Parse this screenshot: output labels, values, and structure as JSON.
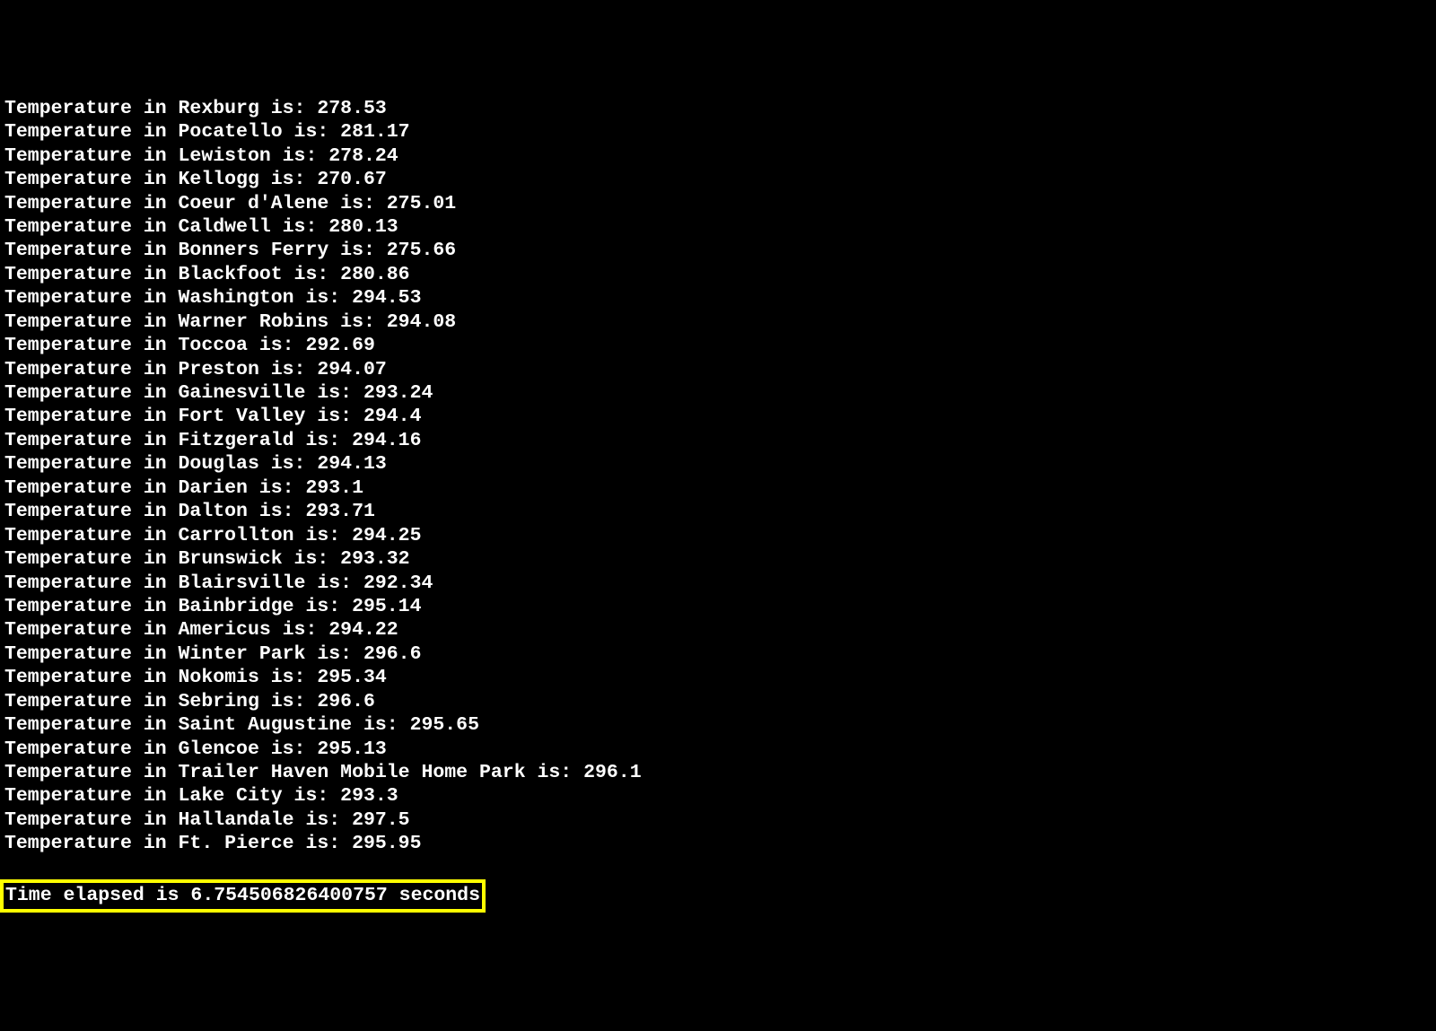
{
  "prefix": "Temperature in ",
  "separator": " is: ",
  "temperatures": [
    {
      "city": "Rexburg",
      "value": "278.53"
    },
    {
      "city": "Pocatello",
      "value": "281.17"
    },
    {
      "city": "Lewiston",
      "value": "278.24"
    },
    {
      "city": "Kellogg",
      "value": "270.67"
    },
    {
      "city": "Coeur d'Alene",
      "value": "275.01"
    },
    {
      "city": "Caldwell",
      "value": "280.13"
    },
    {
      "city": "Bonners Ferry",
      "value": "275.66"
    },
    {
      "city": "Blackfoot",
      "value": "280.86"
    },
    {
      "city": "Washington",
      "value": "294.53"
    },
    {
      "city": "Warner Robins",
      "value": "294.08"
    },
    {
      "city": "Toccoa",
      "value": "292.69"
    },
    {
      "city": "Preston",
      "value": "294.07"
    },
    {
      "city": "Gainesville",
      "value": "293.24"
    },
    {
      "city": "Fort Valley",
      "value": "294.4"
    },
    {
      "city": "Fitzgerald",
      "value": "294.16"
    },
    {
      "city": "Douglas",
      "value": "294.13"
    },
    {
      "city": "Darien",
      "value": "293.1"
    },
    {
      "city": "Dalton",
      "value": "293.71"
    },
    {
      "city": "Carrollton",
      "value": "294.25"
    },
    {
      "city": "Brunswick",
      "value": "293.32"
    },
    {
      "city": "Blairsville",
      "value": "292.34"
    },
    {
      "city": "Bainbridge",
      "value": "295.14"
    },
    {
      "city": "Americus",
      "value": "294.22"
    },
    {
      "city": "Winter Park",
      "value": "296.6"
    },
    {
      "city": "Nokomis",
      "value": "295.34"
    },
    {
      "city": "Sebring",
      "value": "296.6"
    },
    {
      "city": "Saint Augustine",
      "value": "295.65"
    },
    {
      "city": "Glencoe",
      "value": "295.13"
    },
    {
      "city": "Trailer Haven Mobile Home Park",
      "value": "296.1"
    },
    {
      "city": "Lake City",
      "value": "293.3"
    },
    {
      "city": "Hallandale",
      "value": "297.5"
    },
    {
      "city": "Ft. Pierce",
      "value": "295.95"
    }
  ],
  "elapsed": {
    "prefix": "Time elapsed is ",
    "value": "6.754506826400757",
    "suffix": " seconds"
  }
}
